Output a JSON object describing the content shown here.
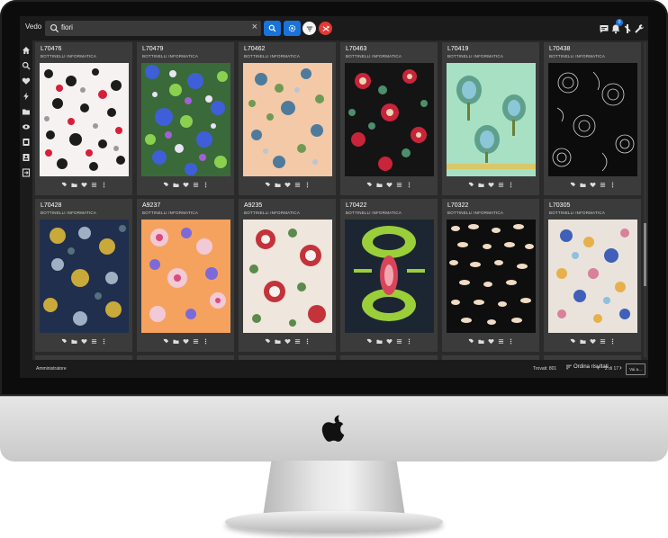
{
  "app": {
    "brand": "Vedo"
  },
  "search": {
    "value": "fiori"
  },
  "header_icons": [
    "chat-icon",
    "bell-icon",
    "user-icon",
    "wrench-icon"
  ],
  "notifications_count": "0",
  "sidebar_icons": [
    "home-icon",
    "search-icon",
    "heart-icon",
    "flash-icon",
    "folder-icon",
    "eye-icon",
    "document-icon",
    "contact-icon",
    "logout-icon"
  ],
  "cards": [
    {
      "code": "L70476",
      "owner": "BOTTINELLI INFORMATICA"
    },
    {
      "code": "L70479",
      "owner": "BOTTINELLI INFORMATICA"
    },
    {
      "code": "L70462",
      "owner": "BOTTINELLI INFORMATICA"
    },
    {
      "code": "L70463",
      "owner": "BOTTINELLI INFORMATICA"
    },
    {
      "code": "L70419",
      "owner": "BOTTINELLI INFORMATICA"
    },
    {
      "code": "L70438",
      "owner": "BOTTINELLI INFORMATICA"
    },
    {
      "code": "L70428",
      "owner": "BOTTINELLI INFORMATICA"
    },
    {
      "code": "A9237",
      "owner": "BOTTINELLI INFORMATICA"
    },
    {
      "code": "A9235",
      "owner": "BOTTINELLI INFORMATICA"
    },
    {
      "code": "L70422",
      "owner": "BOTTINELLI INFORMATICA"
    },
    {
      "code": "L70322",
      "owner": "BOTTINELLI INFORMATICA"
    },
    {
      "code": "L70305",
      "owner": "BOTTINELLI INFORMATICA"
    }
  ],
  "card_actions": [
    "tag-icon",
    "folder-icon",
    "heart-icon",
    "list-icon",
    "more-icon"
  ],
  "footer": {
    "role": "Amministratore",
    "found": "Trovati: 801",
    "sort_label": "Ordina risultati",
    "page": "2 di 17",
    "goto_label": "Vai a..."
  },
  "colors": {
    "accent": "#1a73d9",
    "danger": "#e53935",
    "surface": "#2a2a2a",
    "card": "#3b3b3b"
  }
}
